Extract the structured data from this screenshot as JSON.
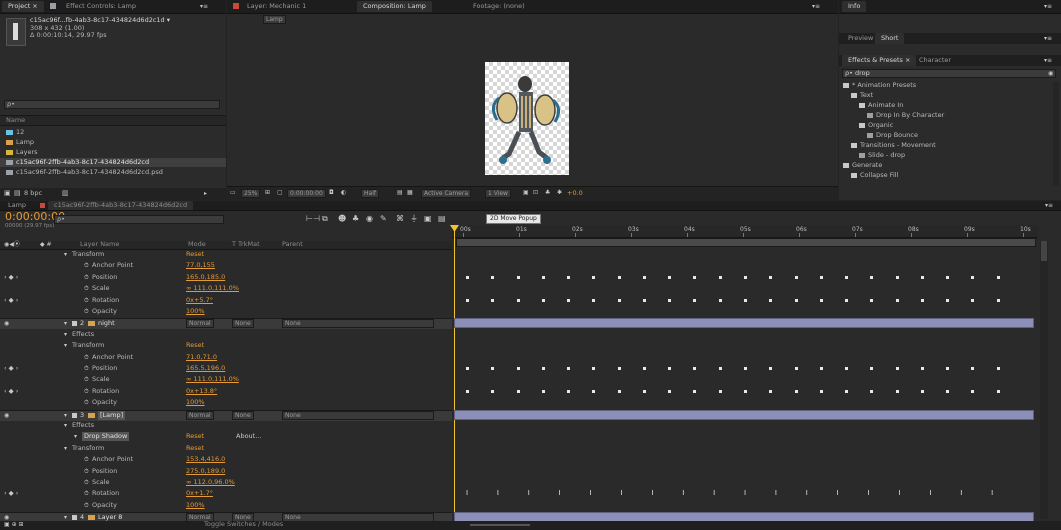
{
  "project": {
    "tab_label": "Project ×",
    "effect_controls_label": "Effect Controls: Lamp",
    "item_name": "c15ac96f...fb-4ab3-8c17-434824d6d2c1d ▾",
    "item_meta1": "308 x 432 (1.00)",
    "item_meta2": "Δ 0:00:10:14, 29.97 fps",
    "search_placeholder": "ρ•",
    "col_name": "Name",
    "items": [
      {
        "label": "12",
        "color": "#6ec1e4"
      },
      {
        "label": "Lamp",
        "color": "#d9a24a"
      },
      {
        "label": "Layers",
        "color": "#d6b640"
      },
      {
        "label": "c15ac96f-2ffb-4ab3-8c17-434824d6d2cd",
        "color": "#9aa0a6"
      },
      {
        "label": "c15ac96f-2ffb-4ab3-8c17-434824d6d2cd.psd",
        "color": "#9aa0a6"
      }
    ],
    "footer": "8 bpc"
  },
  "viewer": {
    "tabs": [
      "Layer: Mechanic 1",
      "Composition: Lamp",
      "Footage: (none)"
    ],
    "sub_tab": "Lamp",
    "zoom": "25%",
    "timecode": "0:00:00:00",
    "resolution": "Half",
    "camera": "Active Camera",
    "views": "1 View",
    "exposure": "+0.0"
  },
  "right": {
    "info_tab": "Info",
    "tabs2": [
      "Preview",
      "Short"
    ],
    "effects_tab": "Effects & Presets ×",
    "character_tab": "Character",
    "search_value": "ρ• drop",
    "tree": [
      {
        "label": "* Animation Presets",
        "indent": 0
      },
      {
        "label": "Text",
        "indent": 1
      },
      {
        "label": "Animate In",
        "indent": 2
      },
      {
        "label": "Drop In By Character",
        "indent": 3
      },
      {
        "label": "Organic",
        "indent": 2
      },
      {
        "label": "Drop Bounce",
        "indent": 3
      },
      {
        "label": "Transitions - Movement",
        "indent": 1
      },
      {
        "label": "Slide - drop",
        "indent": 2
      },
      {
        "label": "Generate",
        "indent": 0
      },
      {
        "label": "Collapse Fill",
        "indent": 1
      }
    ]
  },
  "timeline": {
    "tabs": [
      "Lamp",
      "c15ac96f-2ffb-4ab3-8c17-434824d6d2cd"
    ],
    "timecode": "0:00:00:00",
    "frame_info": "00000 (29.97 fps)",
    "search_placeholder": "ρ•",
    "tooltip": "2D Move Popup",
    "col_layer_name": "Layer Name",
    "col_mode": "Mode",
    "col_trkmat": "T TrkMat",
    "col_parent": "Parent",
    "ruler_ticks": [
      "00s",
      "01s",
      "02s",
      "03s",
      "04s",
      "05s",
      "06s",
      "07s",
      "08s",
      "09s",
      "10s"
    ],
    "rows": [
      {
        "name": "Transform",
        "value": "Reset",
        "indent": 2,
        "type": "group"
      },
      {
        "name": "Anchor Point",
        "value": "77.0,155",
        "indent": 4,
        "type": "prop"
      },
      {
        "name": "Position",
        "value": "165.0,185.0",
        "indent": 4,
        "type": "prop",
        "keyed": true
      },
      {
        "name": "Scale",
        "value": "∞ 111.0,111.0%",
        "indent": 4,
        "type": "prop"
      },
      {
        "name": "Rotation",
        "value": "0x+5.7°",
        "indent": 4,
        "type": "prop",
        "keyed": true
      },
      {
        "name": "Opacity",
        "value": "100%",
        "indent": 4,
        "type": "prop"
      },
      {
        "num": "2",
        "name": "night",
        "mode": "Normal",
        "trk": "None",
        "parent": "None",
        "type": "layer"
      },
      {
        "name": "Effects",
        "indent": 2,
        "type": "group"
      },
      {
        "name": "Transform",
        "value": "Reset",
        "indent": 2,
        "type": "group"
      },
      {
        "name": "Anchor Point",
        "value": "71.0,71.0",
        "indent": 4,
        "type": "prop"
      },
      {
        "name": "Position",
        "value": "165.5,196.0",
        "indent": 4,
        "type": "prop",
        "keyed": true
      },
      {
        "name": "Scale",
        "value": "∞ 111.0,111.0%",
        "indent": 4,
        "type": "prop"
      },
      {
        "name": "Rotation",
        "value": "0x+13.8°",
        "indent": 4,
        "type": "prop",
        "keyed": true
      },
      {
        "name": "Opacity",
        "value": "100%",
        "indent": 4,
        "type": "prop"
      },
      {
        "num": "3",
        "name": "[Lamp]",
        "mode": "Normal",
        "trk": "None",
        "parent": "None",
        "type": "layer"
      },
      {
        "name": "Effects",
        "indent": 2,
        "type": "group"
      },
      {
        "name": "Drop Shadow",
        "value": "Reset",
        "extra": "About...",
        "indent": 3,
        "type": "fx"
      },
      {
        "name": "Transform",
        "value": "Reset",
        "indent": 2,
        "type": "group"
      },
      {
        "name": "Anchor Point",
        "value": "153.4,416.0",
        "indent": 4,
        "type": "prop"
      },
      {
        "name": "Position",
        "value": "275.0,189.0",
        "indent": 4,
        "type": "prop"
      },
      {
        "name": "Scale",
        "value": "∞ 112.0,96.0%",
        "indent": 4,
        "type": "prop"
      },
      {
        "name": "Rotation",
        "value": "0x+1.7°",
        "indent": 4,
        "type": "prop",
        "keyed": true
      },
      {
        "name": "Opacity",
        "value": "100%",
        "indent": 4,
        "type": "prop"
      },
      {
        "num": "4",
        "name": "Layer 8",
        "mode": "Normal",
        "trk": "None",
        "parent": "None",
        "type": "layer"
      }
    ],
    "footer": "Toggle Switches / Modes"
  },
  "colors": {
    "accent": "#e59a36",
    "layer_bar": "#8c8fb8",
    "playhead": "#f2c12e",
    "label_red": "#c94a3a"
  }
}
